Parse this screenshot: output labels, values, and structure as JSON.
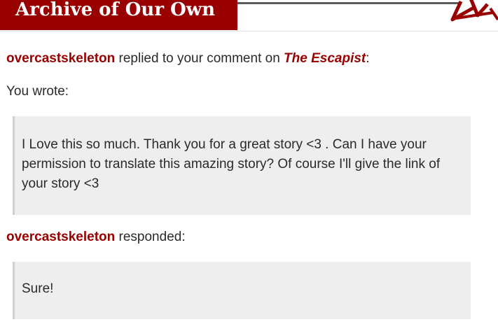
{
  "header": {
    "site_title": "Archive of Our Own"
  },
  "notification": {
    "username": "overcastskeleton",
    "replied_text": " replied to your comment on ",
    "work_title": "The Escapist",
    "colon": ":"
  },
  "original_comment": {
    "label": "You wrote:",
    "text": "I Love this so much. Thank you for a great story <3 . Can I have your permission to translate this amazing story? Of course I'll give the link of your story <3"
  },
  "reply": {
    "username": "overcastskeleton",
    "responded_text": " responded:",
    "text": "Sure!"
  },
  "colors": {
    "brand": "#990000",
    "quote_bg": "#eeeeee"
  }
}
